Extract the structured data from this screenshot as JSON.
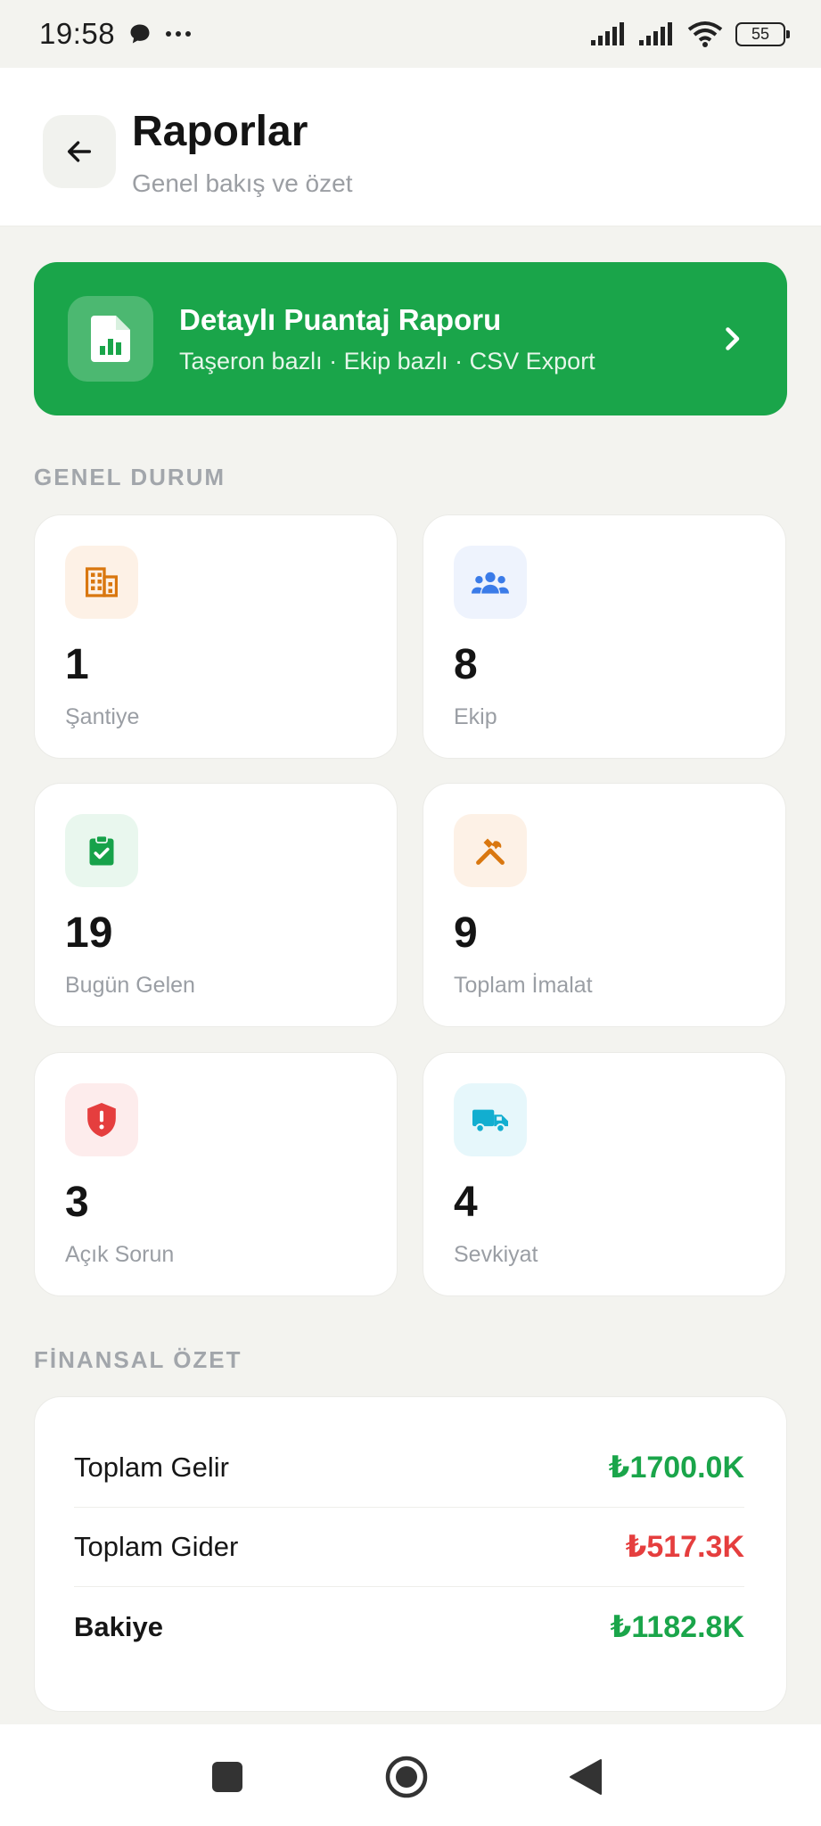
{
  "status_bar": {
    "time": "19:58",
    "battery": "55"
  },
  "header": {
    "title": "Raporlar",
    "subtitle": "Genel bakış ve özet"
  },
  "banner": {
    "title": "Detaylı Puantaj Raporu",
    "subtitle": "Taşeron bazlı · Ekip bazlı · CSV Export"
  },
  "general": {
    "section_title": "GENEL DURUM",
    "cards": [
      {
        "value": "1",
        "label": "Şantiye",
        "icon": "building-icon",
        "icon_color": "#d9770f",
        "bg_color": "#fdf1e6"
      },
      {
        "value": "8",
        "label": "Ekip",
        "icon": "team-icon",
        "icon_color": "#3b7be8",
        "bg_color": "#eef3fd"
      },
      {
        "value": "19",
        "label": "Bugün Gelen",
        "icon": "clipboard-check-icon",
        "icon_color": "#17a24a",
        "bg_color": "#e9f7ee"
      },
      {
        "value": "9",
        "label": "Toplam İmalat",
        "icon": "tools-icon",
        "icon_color": "#d9770f",
        "bg_color": "#fdf1e6"
      },
      {
        "value": "3",
        "label": "Açık Sorun",
        "icon": "shield-alert-icon",
        "icon_color": "#e53e3e",
        "bg_color": "#fdecec"
      },
      {
        "value": "4",
        "label": "Sevkiyat",
        "icon": "truck-icon",
        "icon_color": "#12aed0",
        "bg_color": "#e6f7fb"
      }
    ]
  },
  "finance": {
    "section_title": "FİNANSAL ÖZET",
    "rows": [
      {
        "label": "Toplam Gelir",
        "value": "₺1700.0K",
        "color": "#1aa54a"
      },
      {
        "label": "Toplam Gider",
        "value": "₺517.3K",
        "color": "#e53e3e"
      },
      {
        "label": "Bakiye",
        "value": "₺1182.8K",
        "color": "#1aa54a"
      }
    ]
  },
  "colors": {
    "accent": "#1aa54a",
    "background": "#f3f3ef",
    "danger": "#e53e3e"
  }
}
